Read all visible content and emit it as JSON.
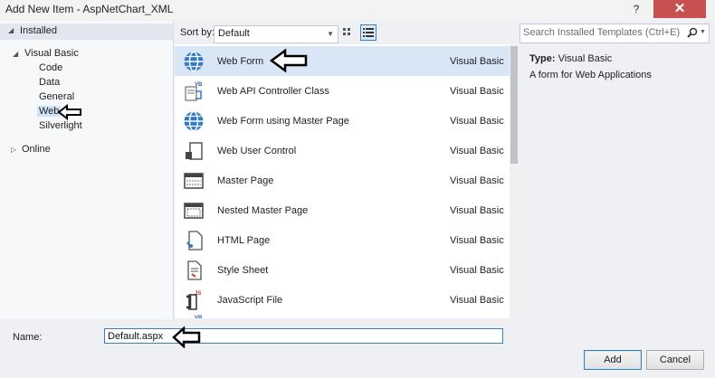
{
  "window": {
    "title": "Add New Item - AspNetChart_XML",
    "help": "?",
    "close": "✕"
  },
  "left": {
    "installed": "Installed",
    "tree": [
      {
        "label": "Visual Basic"
      },
      {
        "label": "Code"
      },
      {
        "label": "Data"
      },
      {
        "label": "General"
      },
      {
        "label": "Web",
        "selected": true
      },
      {
        "label": "Silverlight"
      },
      {
        "label": "Online"
      }
    ]
  },
  "sort": {
    "label": "Sort by:",
    "value": "Default"
  },
  "search": {
    "placeholder": "Search Installed Templates (Ctrl+E)"
  },
  "templates": [
    {
      "name": "Web Form",
      "language": "Visual Basic",
      "icon": "globe-icon",
      "selected": true
    },
    {
      "name": "Web API Controller Class",
      "language": "Visual Basic",
      "icon": "vb-controller-icon"
    },
    {
      "name": "Web Form using Master Page",
      "language": "Visual Basic",
      "icon": "globe-icon"
    },
    {
      "name": "Web User Control",
      "language": "Visual Basic",
      "icon": "user-control-icon"
    },
    {
      "name": "Master Page",
      "language": "Visual Basic",
      "icon": "master-page-icon"
    },
    {
      "name": "Nested Master Page",
      "language": "Visual Basic",
      "icon": "nested-master-page-icon"
    },
    {
      "name": "HTML Page",
      "language": "Visual Basic",
      "icon": "html-page-icon"
    },
    {
      "name": "Style Sheet",
      "language": "Visual Basic",
      "icon": "style-sheet-icon"
    },
    {
      "name": "JavaScript File",
      "language": "Visual Basic",
      "icon": "javascript-file-icon"
    }
  ],
  "details": {
    "type_label": "Type:",
    "type_value": "Visual Basic",
    "description": "A form for Web Applications"
  },
  "name_field": {
    "label": "Name:",
    "value": "Default.aspx"
  },
  "buttons": {
    "add": "Add",
    "cancel": "Cancel"
  },
  "colors": {
    "selection": "#d8e6f6",
    "accent": "#3c7fb1",
    "close": "#c75050"
  }
}
